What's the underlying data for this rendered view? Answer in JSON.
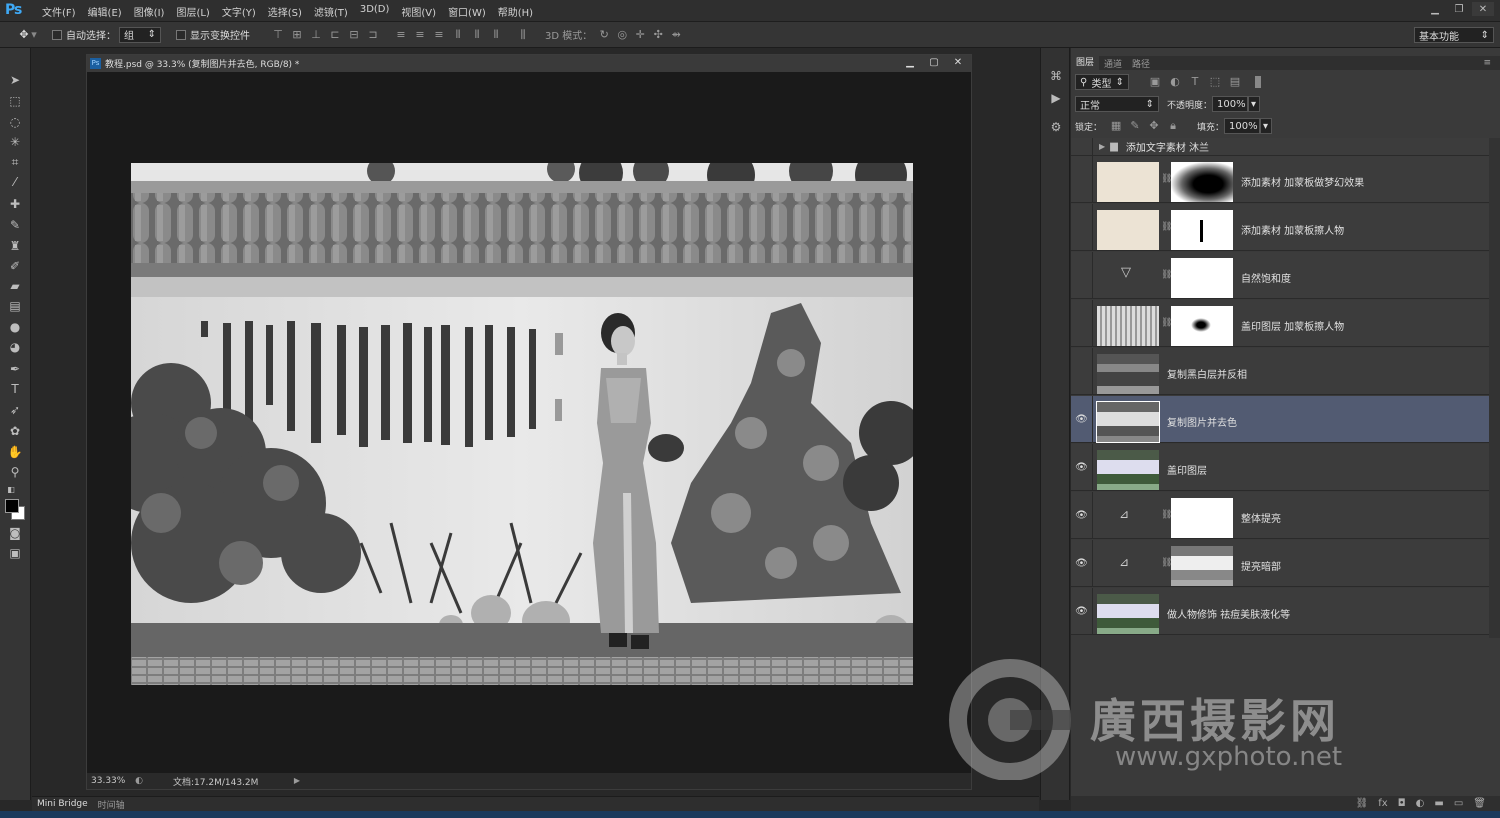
{
  "app": {
    "logo": "Ps"
  },
  "menu": [
    "文件(F)",
    "编辑(E)",
    "图像(I)",
    "图层(L)",
    "文字(Y)",
    "选择(S)",
    "滤镜(T)",
    "3D(D)",
    "视图(V)",
    "窗口(W)",
    "帮助(H)"
  ],
  "options": {
    "auto_select_label": "自动选择：",
    "auto_select_value": "组",
    "show_transform_label": "显示变换控件",
    "mode3d_label": "3D 模式：",
    "workspace_value": "基本功能"
  },
  "document": {
    "title": "教程.psd @ 33.3% (复制图片并去色, RGB/8) *",
    "zoom": "33.33%",
    "docsize": "文档:17.2M/143.2M"
  },
  "bottom_tabs": [
    "Mini Bridge",
    "时间轴"
  ],
  "panel": {
    "tabs": [
      "图层",
      "通道",
      "路径"
    ],
    "filter_kind": "类型",
    "blend_mode": "正常",
    "opacity_label": "不透明度：",
    "opacity_value": "100%",
    "lock_label": "锁定：",
    "fill_label": "填充：",
    "fill_value": "100%",
    "group_name": "添加文字素材   沐兰",
    "layers": [
      {
        "name": "添加素材   加蒙板做梦幻效果",
        "visible": false
      },
      {
        "name": "添加素材   加蒙板擦人物",
        "visible": false
      },
      {
        "name": "自然饱和度",
        "visible": false
      },
      {
        "name": "盖印图层   加蒙板擦人物",
        "visible": false
      },
      {
        "name": "复制黑白层并反相",
        "visible": false
      },
      {
        "name": "复制图片并去色",
        "visible": true,
        "selected": true
      },
      {
        "name": "盖印图层",
        "visible": true
      },
      {
        "name": "整体提亮",
        "visible": true
      },
      {
        "name": "提亮暗部",
        "visible": true
      },
      {
        "name": "做人物修饰   祛痘美肤液化等",
        "visible": true
      }
    ]
  },
  "watermark": {
    "cn": "廣西摄影网",
    "url": "www.gxphoto.net"
  },
  "colors": {
    "selected_layer": "#525b72",
    "accent": "#3fa9f5"
  }
}
